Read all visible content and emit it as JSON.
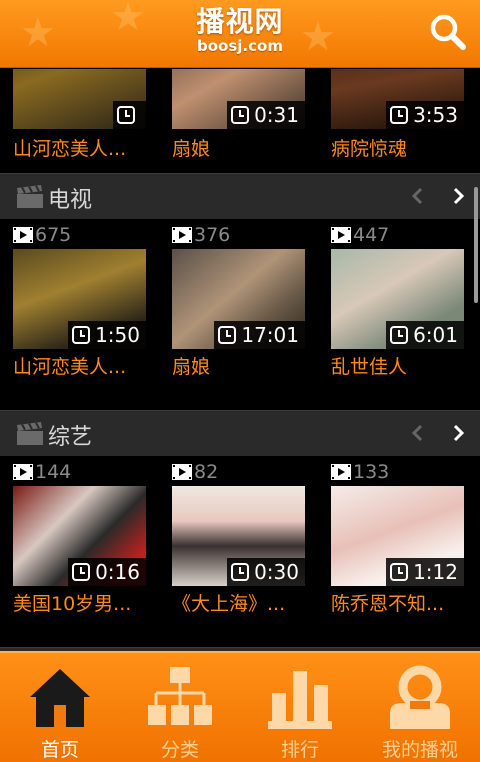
{
  "app": {
    "logo_cn": "播视网",
    "logo_en": "boosj.com",
    "colors": {
      "brand_orange": "#f27800",
      "title_orange": "#ff8a1a"
    }
  },
  "header": {
    "search_icon": "search-icon"
  },
  "top_row": {
    "items": [
      {
        "duration": "",
        "title": "山河恋美人..."
      },
      {
        "duration": "0:31",
        "title": "扇娘"
      },
      {
        "duration": "3:53",
        "title": "病院惊魂"
      }
    ]
  },
  "sections": [
    {
      "label": "电视",
      "items": [
        {
          "views": "675",
          "duration": "1:50",
          "title": "山河恋美人..."
        },
        {
          "views": "376",
          "duration": "17:01",
          "title": "扇娘"
        },
        {
          "views": "447",
          "duration": "6:01",
          "title": "乱世佳人"
        }
      ]
    },
    {
      "label": "综艺",
      "items": [
        {
          "views": "144",
          "duration": "0:16",
          "title": "美国10岁男..."
        },
        {
          "views": "82",
          "duration": "0:30",
          "title": "《大上海》..."
        },
        {
          "views": "133",
          "duration": "1:12",
          "title": "陈乔恩不知..."
        }
      ]
    }
  ],
  "bottom_nav": {
    "tabs": [
      {
        "label": "首页",
        "icon": "home-icon",
        "active": true
      },
      {
        "label": "分类",
        "icon": "category-icon",
        "active": false
      },
      {
        "label": "排行",
        "icon": "ranking-icon",
        "active": false
      },
      {
        "label": "我的播视",
        "icon": "profile-icon",
        "active": false
      }
    ]
  }
}
